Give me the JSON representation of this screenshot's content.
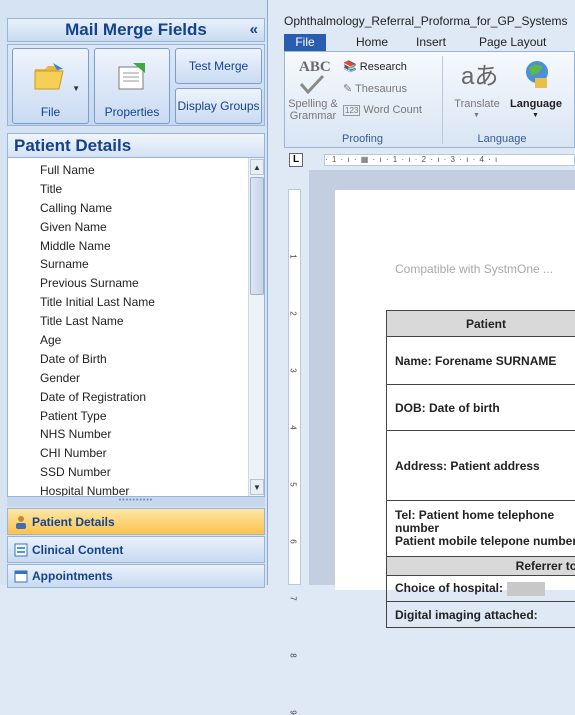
{
  "mail_merge": {
    "title": "Mail Merge Fields",
    "collapse": "«",
    "toolbar": {
      "file": "File",
      "properties": "Properties",
      "test_merge": "Test Merge",
      "display_groups": "Display Groups"
    }
  },
  "patient_details": {
    "title": "Patient Details",
    "fields": [
      "Full Name",
      "Title",
      "Calling Name",
      "Given Name",
      "Middle Name",
      "Surname",
      "Previous Surname",
      "Title Initial Last Name",
      "Title Last Name",
      "Age",
      "Date of Birth",
      "Gender",
      "Date of Registration",
      "Patient Type",
      "NHS Number",
      "CHI Number",
      "SSD Number",
      "Hospital Number"
    ]
  },
  "nav": {
    "patient_details": "Patient Details",
    "clinical_content": "Clinical Content",
    "appointments": "Appointments"
  },
  "word": {
    "window_title": "Ophthalmology_Referral_Proforma_for_GP_Systems",
    "tabs": {
      "file": "File",
      "home": "Home",
      "insert": "Insert",
      "page_layout": "Page Layout"
    },
    "ribbon": {
      "spelling": "Spelling &",
      "grammar": "Grammar",
      "research": "Research",
      "thesaurus": "Thesaurus",
      "word_count": "Word Count",
      "translate": "Translate",
      "language": "Language",
      "proofing": "Proofing",
      "language_group": "Language",
      "abc": "ABC"
    },
    "ruler_text": "· 1 · ı · ▦ · ı · 1 · ı · 2 · ı · 3 · ı · 4 · ı",
    "tab_selector": "L",
    "vruler": [
      "1",
      "2",
      "3",
      "4",
      "5",
      "6",
      "7",
      "8",
      "9"
    ]
  },
  "document": {
    "compat": "Compatible with SystmOne ...",
    "patient_header": "Patient",
    "name": "Name:  Forename SURNAME",
    "dob": "DOB:  Date of birth",
    "address": "Address:  Patient address",
    "tel1": "Tel:  Patient home telephone",
    "tel2": "number",
    "tel3": "Patient mobile telepone number",
    "referrer": "Referrer to",
    "hospital": "Choice of hospital:",
    "imaging": "Digital imaging attached:"
  }
}
